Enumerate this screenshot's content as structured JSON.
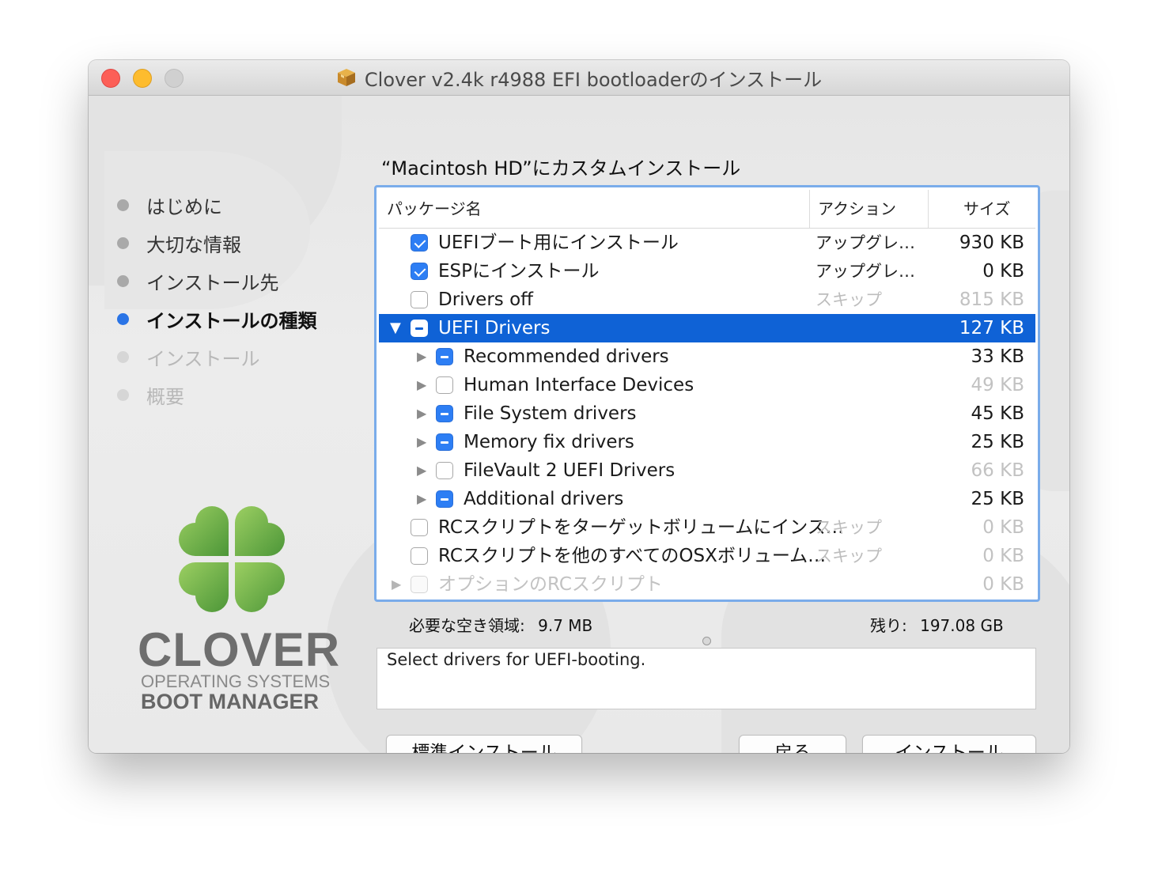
{
  "window": {
    "title": "Clover v2.4k r4988 EFI bootloaderのインストール",
    "title_icon": "package-icon"
  },
  "sidebar": {
    "steps": [
      {
        "label": "はじめに",
        "state": "done"
      },
      {
        "label": "大切な情報",
        "state": "done"
      },
      {
        "label": "インストール先",
        "state": "done"
      },
      {
        "label": "インストールの種類",
        "state": "active"
      },
      {
        "label": "インストール",
        "state": "future"
      },
      {
        "label": "概要",
        "state": "future"
      }
    ],
    "logo": {
      "word": "CLOVER",
      "sub1": "OPERATING SYSTEMS",
      "sub2": "BOOT MANAGER",
      "leaf_color_light": "#8fc85a",
      "leaf_color_dark": "#4f9a3a"
    }
  },
  "main": {
    "heading": "“Macintosh HD”にカスタムインストール",
    "table": {
      "columns": [
        "パッケージ名",
        "アクション",
        "サイズ"
      ],
      "rows": [
        {
          "name": "UEFIブート用にインストール",
          "check": "checked",
          "action": "アップグレ…",
          "size": "930 KB"
        },
        {
          "name": "ESPにインストール",
          "check": "checked",
          "action": "アップグレ…",
          "size": "0 KB"
        },
        {
          "name": "Drivers off",
          "check": "unchecked",
          "action": "スキップ",
          "size": "815 KB"
        },
        {
          "name": "UEFI Drivers",
          "check": "mixed",
          "action": "",
          "size": "127 KB"
        },
        {
          "name": "Recommended drivers",
          "check": "mixed",
          "action": "",
          "size": "33 KB"
        },
        {
          "name": "Human Interface Devices",
          "check": "unchecked",
          "action": "",
          "size": "49 KB"
        },
        {
          "name": "File System drivers",
          "check": "mixed",
          "action": "",
          "size": "45 KB"
        },
        {
          "name": "Memory fix drivers",
          "check": "mixed",
          "action": "",
          "size": "25 KB"
        },
        {
          "name": "FileVault 2 UEFI Drivers",
          "check": "unchecked",
          "action": "",
          "size": "66 KB"
        },
        {
          "name": "Additional drivers",
          "check": "mixed",
          "action": "",
          "size": "25 KB"
        },
        {
          "name": "RCスクリプトをターゲットボリュームにインス…",
          "check": "unchecked",
          "action": "スキップ",
          "size": "0 KB"
        },
        {
          "name": "RCスクリプトを他のすべてのOSXボリューム…",
          "check": "unchecked",
          "action": "スキップ",
          "size": "0 KB"
        },
        {
          "name": "オプションのRCスクリプト",
          "check": "disabled",
          "action": "",
          "size": "0 KB"
        }
      ]
    },
    "space_required_label": "必要な空き領域:",
    "space_required_value": "9.7 MB",
    "remaining_label": "残り:",
    "remaining_value": "197.08 GB",
    "description": "Select drivers for UEFI-booting."
  },
  "buttons": {
    "standard_install": "標準インストール",
    "back": "戻る",
    "install": "インストール"
  },
  "colors": {
    "selection": "#0f62d6",
    "checkbox": "#2d7ef4",
    "focus_ring": "#7aacea"
  }
}
